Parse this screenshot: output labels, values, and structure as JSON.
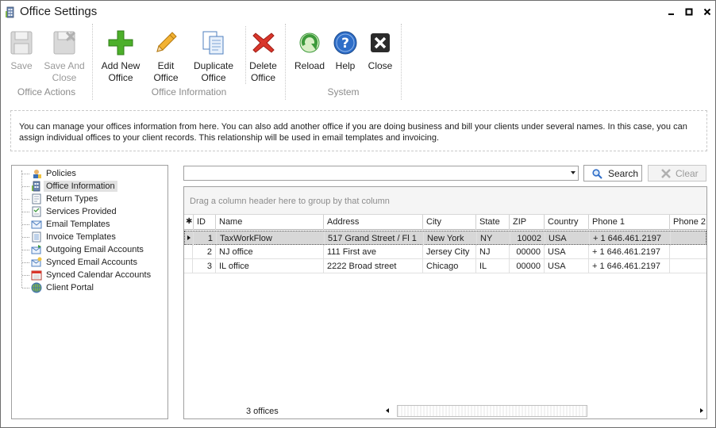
{
  "window": {
    "title": "Office Settings",
    "min_glyph": "▁",
    "max_glyph": "■",
    "close_glyph": "✕"
  },
  "ribbon": {
    "groups": {
      "office_actions": "Office Actions",
      "office_information": "Office Information",
      "system": "System"
    },
    "buttons": {
      "save": [
        "Save",
        ""
      ],
      "save_and_close": [
        "Save And",
        "Close"
      ],
      "add_new_office": [
        "Add New",
        "Office"
      ],
      "edit_office": [
        "Edit",
        "Office"
      ],
      "duplicate_office": [
        "Duplicate",
        "Office"
      ],
      "delete_office": [
        "Delete",
        "Office"
      ],
      "reload": [
        "Reload",
        ""
      ],
      "help": [
        "Help",
        ""
      ],
      "close": [
        "Close",
        ""
      ]
    }
  },
  "info_text": "You can manage your offices information from here. You can also add another office if you are doing business and bill your clients under several names. In this case, you can assign individual offices to your client records. This relationship will be used in email templates and invoicing.",
  "tree": {
    "items": [
      {
        "label": "Policies",
        "icon": "policies-icon"
      },
      {
        "label": "Office Information",
        "icon": "office-building-icon",
        "selected": true
      },
      {
        "label": "Return Types",
        "icon": "return-types-icon"
      },
      {
        "label": "Services Provided",
        "icon": "services-icon"
      },
      {
        "label": "Email Templates",
        "icon": "email-template-icon"
      },
      {
        "label": "Invoice Templates",
        "icon": "invoice-template-icon"
      },
      {
        "label": "Outgoing Email Accounts",
        "icon": "outgoing-email-icon"
      },
      {
        "label": "Synced Email Accounts",
        "icon": "synced-email-icon"
      },
      {
        "label": "Synced Calendar Accounts",
        "icon": "calendar-icon"
      },
      {
        "label": "Client Portal",
        "icon": "globe-icon"
      }
    ]
  },
  "search": {
    "value": "",
    "search_label": "Search",
    "clear_label": "Clear"
  },
  "grid": {
    "group_hint": "Drag a column header here to group by that column",
    "indicator_header": "✱",
    "columns": [
      "ID",
      "Name",
      "Address",
      "City",
      "State",
      "ZIP",
      "Country",
      "Phone 1",
      "Phone 2"
    ],
    "rows": [
      [
        "1",
        "TaxWorkFlow",
        "517 Grand Street / Fl 1",
        "New York",
        "NY",
        "10002",
        "USA",
        "+ 1 646.461.2197",
        ""
      ],
      [
        "2",
        "NJ office",
        "111 First ave",
        "Jersey City",
        "NJ",
        "00000",
        "USA",
        "+ 1 646.461.2197",
        ""
      ],
      [
        "3",
        "IL office",
        "2222 Broad street",
        "Chicago",
        "IL",
        "00000",
        "USA",
        "+ 1 646.461.2197",
        ""
      ]
    ],
    "selected_row": 0,
    "footer_count": "3 offices"
  },
  "colors": {
    "selected_row": "#d7d7d7",
    "disabled_text": "#9a9a9a",
    "group_label": "#8c8c8c",
    "add_green": "#4caf2a",
    "delete_red": "#d9362b",
    "help_blue": "#2f6ec8",
    "reload_green": "#3d9a3b"
  }
}
